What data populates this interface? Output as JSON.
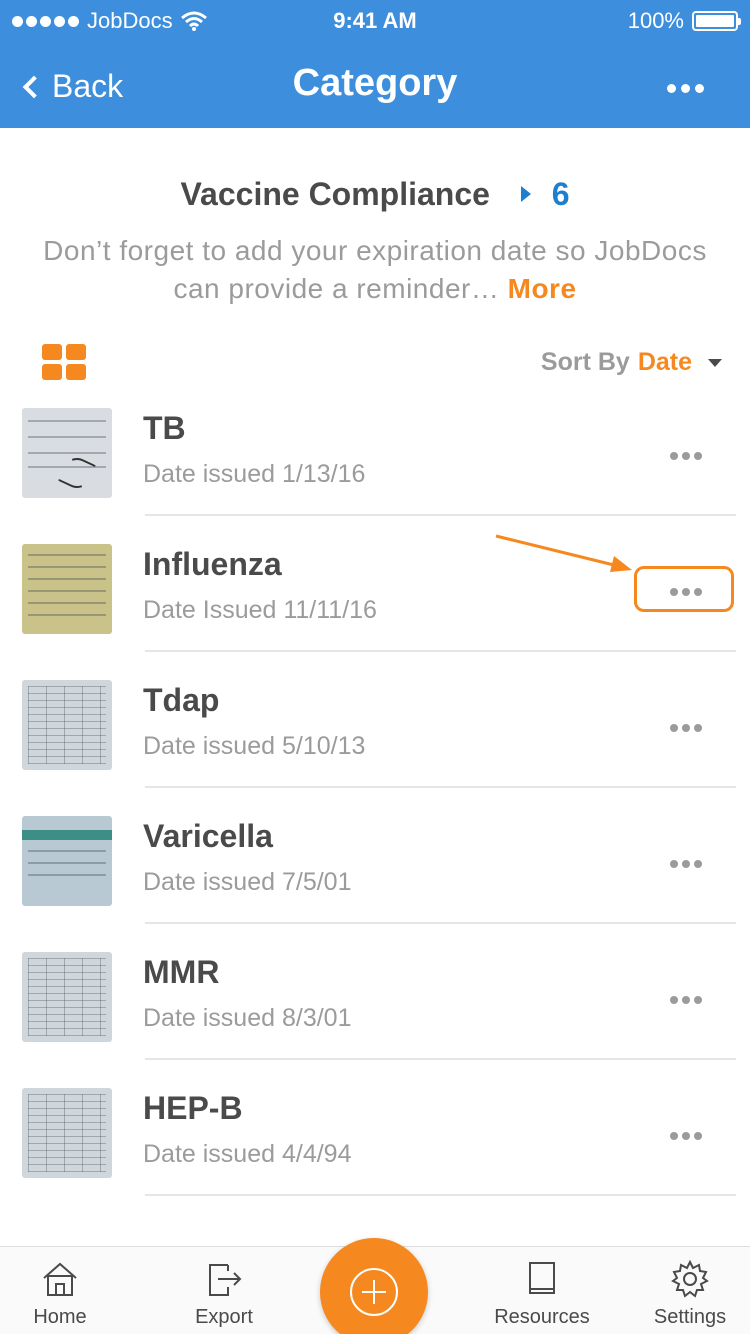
{
  "status_bar": {
    "carrier": "JobDocs",
    "time": "9:41 AM",
    "battery": "100%",
    "battery_level": 1.0
  },
  "nav": {
    "back_label": "Back",
    "title": "Category"
  },
  "category": {
    "name": "Vaccine Compliance",
    "count": "6",
    "description": "Don’t forget to add your expiration date so JobDocs can provide a reminder…",
    "more_label": "More"
  },
  "toolbar": {
    "sort_label": "Sort By",
    "sort_value": "Date"
  },
  "documents": [
    {
      "title": "TB",
      "subtitle": "Date issued 1/13/16"
    },
    {
      "title": "Influenza",
      "subtitle": "Date Issued 11/11/16"
    },
    {
      "title": "Tdap",
      "subtitle": "Date issued 5/10/13"
    },
    {
      "title": "Varicella",
      "subtitle": "Date issued 7/5/01"
    },
    {
      "title": "MMR",
      "subtitle": "Date issued 8/3/01"
    },
    {
      "title": "HEP-B",
      "subtitle": "Date issued 4/4/94"
    }
  ],
  "tabs": {
    "home": "Home",
    "export": "Export",
    "resources": "Resources",
    "settings": "Settings"
  },
  "colors": {
    "header": "#3d8edc",
    "accent": "#f5891f",
    "count": "#1f7fcf"
  },
  "icons": {
    "grid_view": "grid-view-icon",
    "home": "home-icon",
    "export": "export-icon",
    "resources": "book-icon",
    "settings": "gear-icon",
    "add": "plus-icon"
  }
}
